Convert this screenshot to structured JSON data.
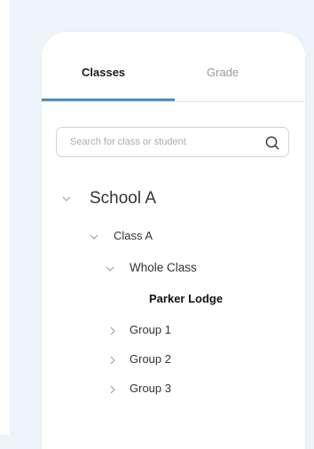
{
  "tabs": {
    "classes_label": "Classes",
    "grade_label": "Grade",
    "active": "Classes",
    "accent_color": "#4a90bf"
  },
  "search": {
    "placeholder": "Search for class or student",
    "value": "",
    "icon": "search-icon"
  },
  "tree": {
    "school": {
      "label": "School A",
      "expanded": true
    },
    "class": {
      "label": "Class A",
      "expanded": true
    },
    "whole_class": {
      "label": "Whole Class",
      "expanded": true
    },
    "student": {
      "label": "Parker Lodge",
      "selected": true
    },
    "groups": [
      {
        "label": "Group 1",
        "expanded": false
      },
      {
        "label": "Group 2",
        "expanded": false
      },
      {
        "label": "Group 3",
        "expanded": false
      }
    ]
  }
}
